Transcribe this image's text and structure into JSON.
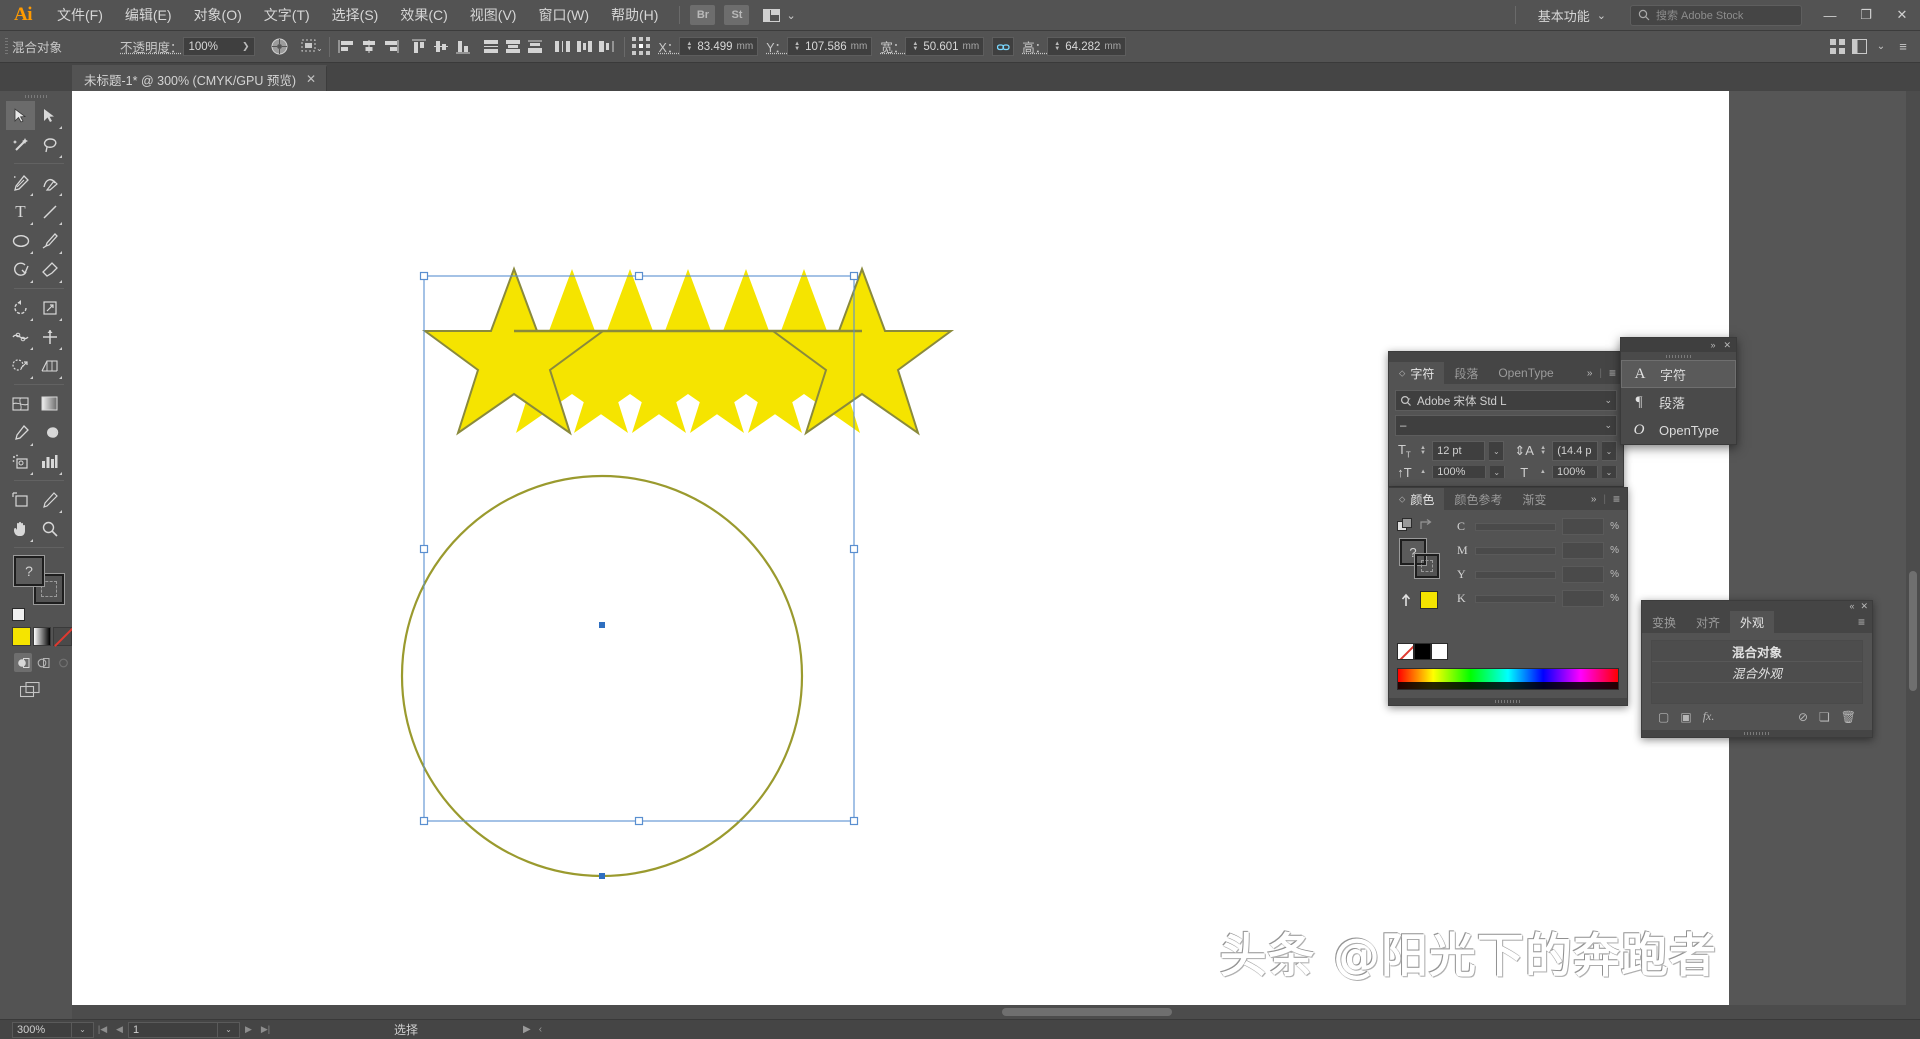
{
  "app": {
    "logo": "Ai",
    "workspace": "基本功能",
    "stock_search_placeholder": "搜索 Adobe Stock",
    "bridge_badge": "Br",
    "stock_badge": "St"
  },
  "menu": {
    "items": [
      {
        "label": "文件(F)"
      },
      {
        "label": "编辑(E)"
      },
      {
        "label": "对象(O)"
      },
      {
        "label": "文字(T)"
      },
      {
        "label": "选择(S)"
      },
      {
        "label": "效果(C)"
      },
      {
        "label": "视图(V)"
      },
      {
        "label": "窗口(W)"
      },
      {
        "label": "帮助(H)"
      }
    ]
  },
  "window_controls": {
    "minimize": "—",
    "restore": "❐",
    "close": "✕"
  },
  "control_bar": {
    "object_type": "混合对象",
    "opacity_label": "不透明度：",
    "opacity_value": "100%",
    "x_label": "X：",
    "x_value": "83.499",
    "x_unit": "mm",
    "y_label": "Y：",
    "y_value": "107.586",
    "y_unit": "mm",
    "w_label": "宽：",
    "w_value": "50.601",
    "w_unit": "mm",
    "h_label": "高：",
    "h_value": "64.282",
    "h_unit": "mm"
  },
  "document_tab": {
    "title": "未标题-1* @ 300% (CMYK/GPU 预览)",
    "close": "✕"
  },
  "toolbar": {
    "tools": [
      {
        "name": "selection-tool",
        "glyph": "➤",
        "selected": true
      },
      {
        "name": "direct-selection-tool",
        "glyph": "➤",
        "selected": false
      },
      {
        "name": "magic-wand-tool",
        "glyph": "✦",
        "selected": false
      },
      {
        "name": "lasso-tool",
        "glyph": "◠",
        "selected": false
      },
      {
        "name": "pen-tool",
        "glyph": "✒",
        "selected": false
      },
      {
        "name": "curvature-tool",
        "glyph": "⌒",
        "selected": false
      },
      {
        "name": "type-tool",
        "glyph": "T",
        "selected": false
      },
      {
        "name": "line-segment-tool",
        "glyph": "／",
        "selected": false
      },
      {
        "name": "ellipse-tool",
        "glyph": "◯",
        "selected": false
      },
      {
        "name": "paintbrush-tool",
        "glyph": "✎",
        "selected": false
      },
      {
        "name": "shaper-tool",
        "glyph": "◌",
        "selected": false
      },
      {
        "name": "eraser-tool",
        "glyph": "◆",
        "selected": false
      },
      {
        "name": "rotate-tool",
        "glyph": "↻",
        "selected": false
      },
      {
        "name": "scale-tool",
        "glyph": "⤢",
        "selected": false
      },
      {
        "name": "width-tool",
        "glyph": "⋈",
        "selected": false
      },
      {
        "name": "free-transform-tool",
        "glyph": "✛",
        "selected": false
      },
      {
        "name": "shape-builder-tool",
        "glyph": "◔",
        "selected": false
      },
      {
        "name": "perspective-grid-tool",
        "glyph": "▨",
        "selected": false
      },
      {
        "name": "mesh-tool",
        "glyph": "▩",
        "selected": false
      },
      {
        "name": "gradient-tool",
        "glyph": "▤",
        "selected": false
      },
      {
        "name": "eyedropper-tool",
        "glyph": "✐",
        "selected": false
      },
      {
        "name": "blend-tool",
        "glyph": "◎",
        "selected": false
      },
      {
        "name": "symbol-sprayer-tool",
        "glyph": "⁂",
        "selected": false
      },
      {
        "name": "column-graph-tool",
        "glyph": "▥",
        "selected": false
      },
      {
        "name": "artboard-tool",
        "glyph": "⊡",
        "selected": false
      },
      {
        "name": "slice-tool",
        "glyph": "✂",
        "selected": false
      },
      {
        "name": "hand-tool",
        "glyph": "✋",
        "selected": false
      },
      {
        "name": "zoom-tool",
        "glyph": "🔍",
        "selected": false
      }
    ],
    "fill_color": "#f5e400",
    "stroke_color": "none",
    "color_modes": [
      "color-swatch",
      "gradient-swatch",
      "none-swatch"
    ],
    "draw_modes": [
      "draw-normal",
      "draw-behind",
      "draw-inside"
    ],
    "screen_mode": "change-screen-mode"
  },
  "character_panel": {
    "tabs": [
      "字符",
      "段落",
      "OpenType"
    ],
    "active_tab": "字符",
    "font_family": "Adobe 宋体 Std L",
    "font_style": "–",
    "font_size": "12 pt",
    "leading": "(14.4 p",
    "vertical_scale": "100%",
    "horizontal_scale": "100%"
  },
  "flyout_menu": {
    "items": [
      {
        "label": "字符",
        "icon": "A",
        "selected": true
      },
      {
        "label": "段落",
        "icon": "¶",
        "selected": false
      },
      {
        "label": "OpenType",
        "icon": "O",
        "selected": false
      }
    ]
  },
  "color_panel": {
    "tabs": [
      "颜色",
      "颜色参考",
      "渐变"
    ],
    "active_tab": "颜色",
    "channels": [
      {
        "label": "C",
        "value": "",
        "unit": "%"
      },
      {
        "label": "M",
        "value": "",
        "unit": "%"
      },
      {
        "label": "Y",
        "value": "",
        "unit": "%"
      },
      {
        "label": "K",
        "value": "",
        "unit": "%"
      }
    ],
    "fill_swatch": "#f5e400",
    "question_mark": "?",
    "none_swatch": "none",
    "black_swatch": "#000000",
    "white_swatch": "#ffffff"
  },
  "appearance_panel": {
    "tabs": [
      "变换",
      "对齐",
      "外观"
    ],
    "active_tab": "外观",
    "rows": [
      {
        "label": "混合对象",
        "style": "bold"
      },
      {
        "label": "混合外观",
        "style": "italic"
      }
    ],
    "footer_icons": [
      "add-new-stroke-icon",
      "add-new-fill-icon",
      "add-fx-icon",
      "clear-appearance-icon",
      "duplicate-item-icon",
      "delete-item-icon"
    ],
    "fx_label": "fx."
  },
  "status_bar": {
    "zoom": "300%",
    "page": "1",
    "status_text": "选择",
    "nav_first": "|◀",
    "nav_prev": "◀",
    "nav_next": "▶",
    "nav_last": "▶|"
  },
  "artwork": {
    "fill_color": "#f5e400",
    "stroke_color": "#8b8b2b",
    "circle_stroke": "#9a9a2e",
    "selection_color": "#4a90d9",
    "star_count": 7,
    "description": "blend-of-stars-and-circle"
  },
  "watermark": {
    "text": "头条 @阳光下的奔跑者"
  }
}
